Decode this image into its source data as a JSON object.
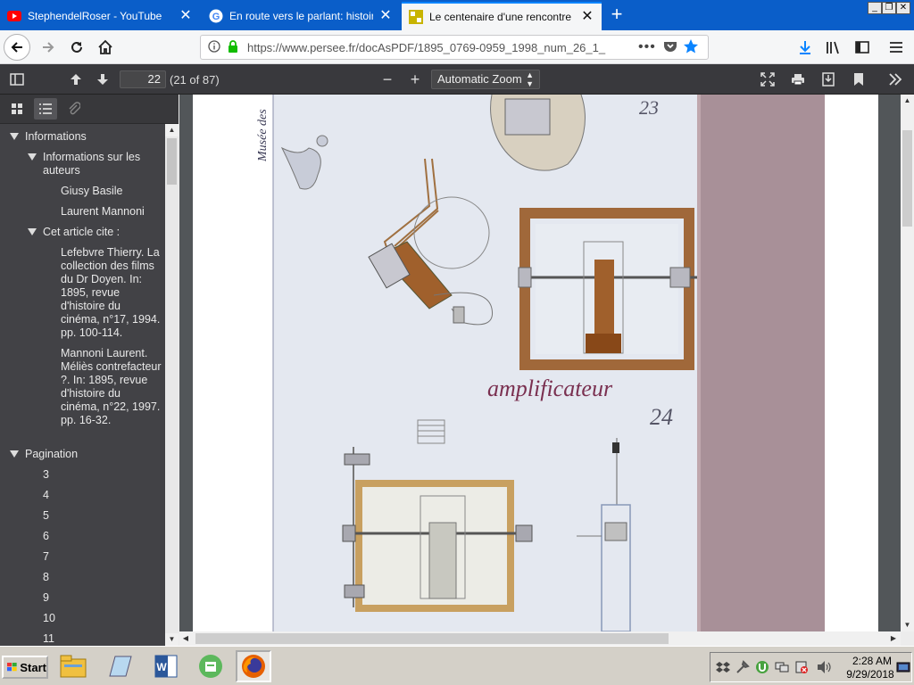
{
  "tabs": [
    {
      "title": "StephendelRoser - YouTube",
      "favicon": "youtube-icon"
    },
    {
      "title": "En route vers le parlant: histoire d",
      "favicon": "google-icon"
    },
    {
      "title": "Le centenaire d'une rencontre : Au",
      "favicon": "persee-icon"
    }
  ],
  "url": "https://www.persee.fr/docAsPDF/1895_0769-0959_1998_num_26_1_",
  "pdf_toolbar": {
    "page_number": "22",
    "page_count": "(21 of 87)",
    "zoom": "Automatic Zoom"
  },
  "outline": {
    "informations": "Informations",
    "authors_info": "Informations sur les auteurs",
    "author1": "Giusy Basile",
    "author2": "Laurent Mannoni",
    "cited_by": "Cet article cite :",
    "cite1": "Lefebvre Thierry. La collection des films du Dr Doyen. In: 1895, revue d'histoire du cinéma, n°17, 1994. pp. 100-114.",
    "cite2": "Mannoni Laurent. Méliès contrefacteur ?. In: 1895, revue d'histoire du cinéma, n°22, 1997. pp. 16-32.",
    "pagination": "Pagination",
    "pages": [
      "3",
      "4",
      "5",
      "6",
      "7",
      "8",
      "9",
      "10",
      "11"
    ]
  },
  "drawing": {
    "caption": "amplificateur",
    "number_top": "23",
    "number_mid": "24",
    "margin_text": "Musée des"
  },
  "taskbar": {
    "start": "Start",
    "time": "2:28 AM",
    "date": "9/29/2018"
  },
  "colors": {
    "tab_bar": "#0a5ec9",
    "pdf_toolbar": "#39393d",
    "sidebar": "#424246",
    "accent_blue": "#0a84ff"
  }
}
